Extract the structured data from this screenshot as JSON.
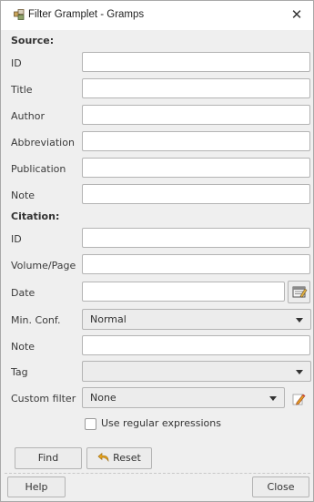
{
  "window": {
    "title": "Filter Gramplet - Gramps"
  },
  "sections": {
    "source": "Source:",
    "citation": "Citation:"
  },
  "source_fields": [
    {
      "label": "ID",
      "value": ""
    },
    {
      "label": "Title",
      "value": ""
    },
    {
      "label": "Author",
      "value": ""
    },
    {
      "label": "Abbreviation",
      "value": ""
    },
    {
      "label": "Publication",
      "value": ""
    },
    {
      "label": "Note",
      "value": ""
    }
  ],
  "citation_fields": {
    "id": {
      "label": "ID",
      "value": ""
    },
    "volume": {
      "label": "Volume/Page",
      "value": ""
    },
    "date": {
      "label": "Date",
      "value": ""
    },
    "min_conf": {
      "label": "Min. Conf.",
      "value": "Normal"
    },
    "note": {
      "label": "Note",
      "value": ""
    },
    "tag": {
      "label": "Tag",
      "value": ""
    },
    "custom_filter": {
      "label": "Custom filter",
      "value": "None"
    }
  },
  "regex": {
    "label": "Use regular expressions",
    "checked": false
  },
  "buttons": {
    "find": "Find",
    "reset": "Reset",
    "help": "Help",
    "close": "Close"
  },
  "icons": {
    "title": "gramps-app-icon",
    "date": "calendar-edit-icon",
    "edit": "pencil-edit-icon",
    "reset": "undo-arrow-icon"
  }
}
